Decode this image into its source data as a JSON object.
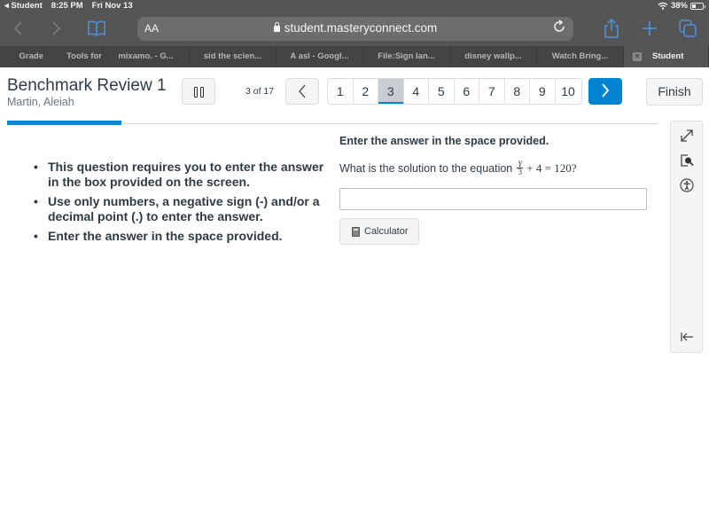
{
  "status_bar": {
    "back_app": "◂ Student",
    "time": "8:25 PM",
    "date": "Fri Nov 13",
    "battery": "38%",
    "battery_level": 0.38
  },
  "browser": {
    "text_size_label": "AA",
    "url": "student.masteryconnect.com",
    "icons": {
      "back": "chevron-left-icon",
      "forward": "chevron-right-icon",
      "bookmarks": "book-icon",
      "lock": "lock-icon",
      "reload": "reload-icon",
      "share": "share-icon",
      "new_tab": "plus-icon",
      "tabs": "tabs-icon"
    },
    "tabs": [
      {
        "label": "Grade",
        "active": false
      },
      {
        "label": "Tools for",
        "active": false
      },
      {
        "label": "mixamo. - G...",
        "active": false
      },
      {
        "label": "sid the scien...",
        "active": false
      },
      {
        "label": "A asl - Googl...",
        "active": false
      },
      {
        "label": "File:Sign lan...",
        "active": false
      },
      {
        "label": "disney wallp...",
        "active": false
      },
      {
        "label": "Watch Bring...",
        "active": false
      },
      {
        "label": "Student",
        "active": true
      }
    ]
  },
  "assessment": {
    "title": "Benchmark Review 1",
    "student_name": "Martin, Aleiah",
    "counter": "3 of 17",
    "current_question": 3,
    "total_questions": 17,
    "progress_fraction": 0.176,
    "pages": [
      "1",
      "2",
      "3",
      "4",
      "5",
      "6",
      "7",
      "8",
      "9",
      "10"
    ],
    "finish_label": "Finish",
    "pause_icon": "pause-icon",
    "prev_icon": "chevron-left-icon",
    "next_icon": "chevron-right-icon",
    "accent_color": "#0084d1"
  },
  "instructions": [
    "This question requires you to enter the answer in the box provided on the screen.",
    "Use only numbers, a negative sign (-) and/or a decimal point (.) to enter the answer.",
    "Enter the answer in the space provided."
  ],
  "question": {
    "heading": "Enter the answer in the space provided.",
    "prompt": "What is the solution to the equation",
    "equation": {
      "numerator": "Y",
      "denominator": "3",
      "rest": "+ 4 = 120?"
    },
    "answer_value": "",
    "calculator_label": "Calculator"
  },
  "tool_rail": {
    "icons": [
      "expand-icon",
      "magnifier-icon",
      "accessibility-icon",
      "collapse-left-icon"
    ]
  }
}
